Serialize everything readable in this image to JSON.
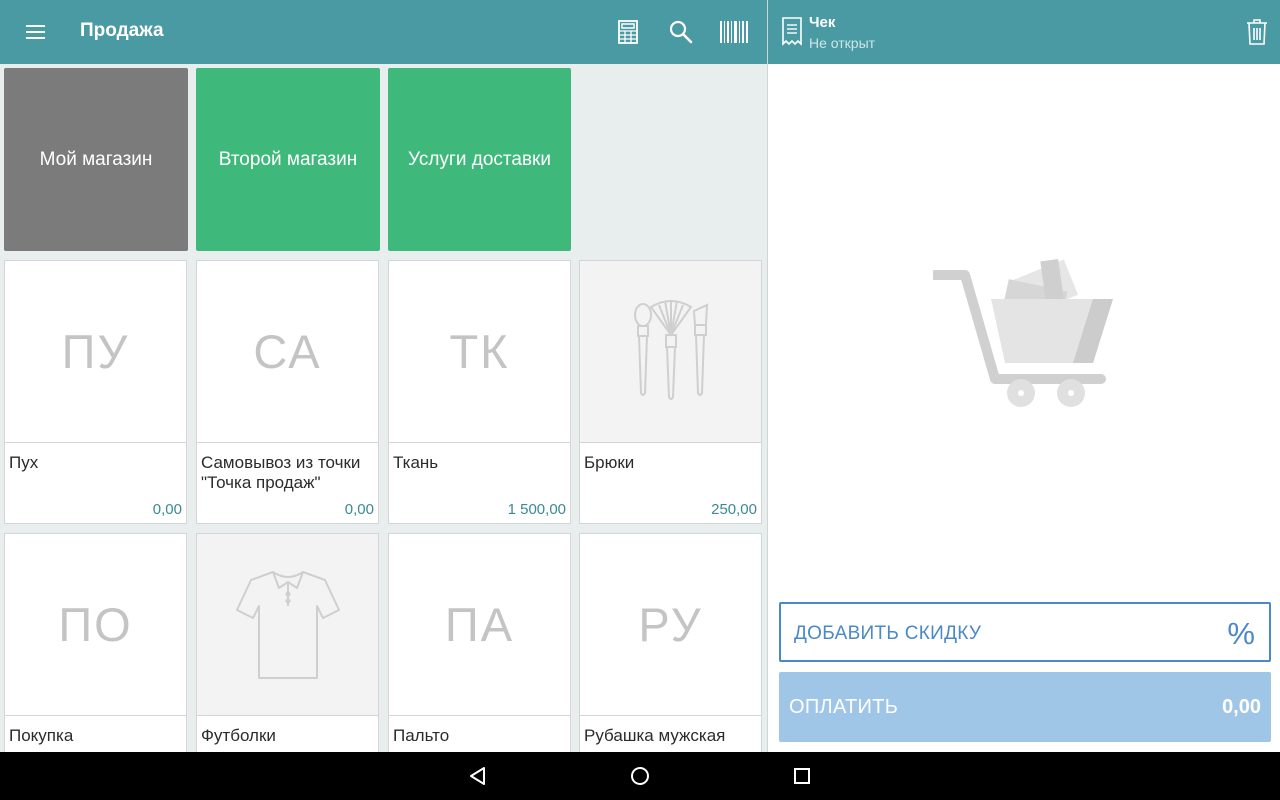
{
  "header": {
    "title": "Продажа",
    "icons": [
      "hamburger-menu-icon",
      "calculator-icon",
      "search-icon",
      "barcode-icon"
    ]
  },
  "categories": [
    {
      "label": "Мой магазин",
      "color": "#7b7b7b"
    },
    {
      "label": "Второй магазин",
      "color": "#3fb97b"
    },
    {
      "label": "Услуги доставки",
      "color": "#3fb97b"
    }
  ],
  "products": [
    {
      "initials": "ПУ",
      "name": "Пух",
      "price": "0,00"
    },
    {
      "initials": "СА",
      "name": "Самовывоз из точки \"Точка продаж\"",
      "price": "0,00"
    },
    {
      "initials": "ТК",
      "name": "Ткань",
      "price": "1 500,00"
    },
    {
      "image": "makeup-brushes-icon",
      "name": "Брюки",
      "price": "250,00"
    },
    {
      "initials": "ПО",
      "name": "Покупка"
    },
    {
      "image": "polo-shirt-icon",
      "name": "Футболки"
    },
    {
      "initials": "ПА",
      "name": "Пальто"
    },
    {
      "initials": "РУ",
      "name": "Рубашка мужская"
    }
  ],
  "receipt": {
    "title": "Чек",
    "status": "Не открыт",
    "empty_image": "empty-cart-icon"
  },
  "discount": {
    "label": "ДОБАВИТЬ СКИДКУ",
    "symbol": "%"
  },
  "pay": {
    "label": "ОПЛАТИТЬ",
    "amount": "0,00"
  },
  "colors": {
    "accent": "#4a9aa4",
    "category_green": "#3fb97b",
    "category_gray": "#7b7b7b",
    "primary_blue": "#4a88c7",
    "pay_disabled": "#9fc6e7"
  },
  "nav": [
    "back-icon",
    "home-icon",
    "recents-icon"
  ]
}
